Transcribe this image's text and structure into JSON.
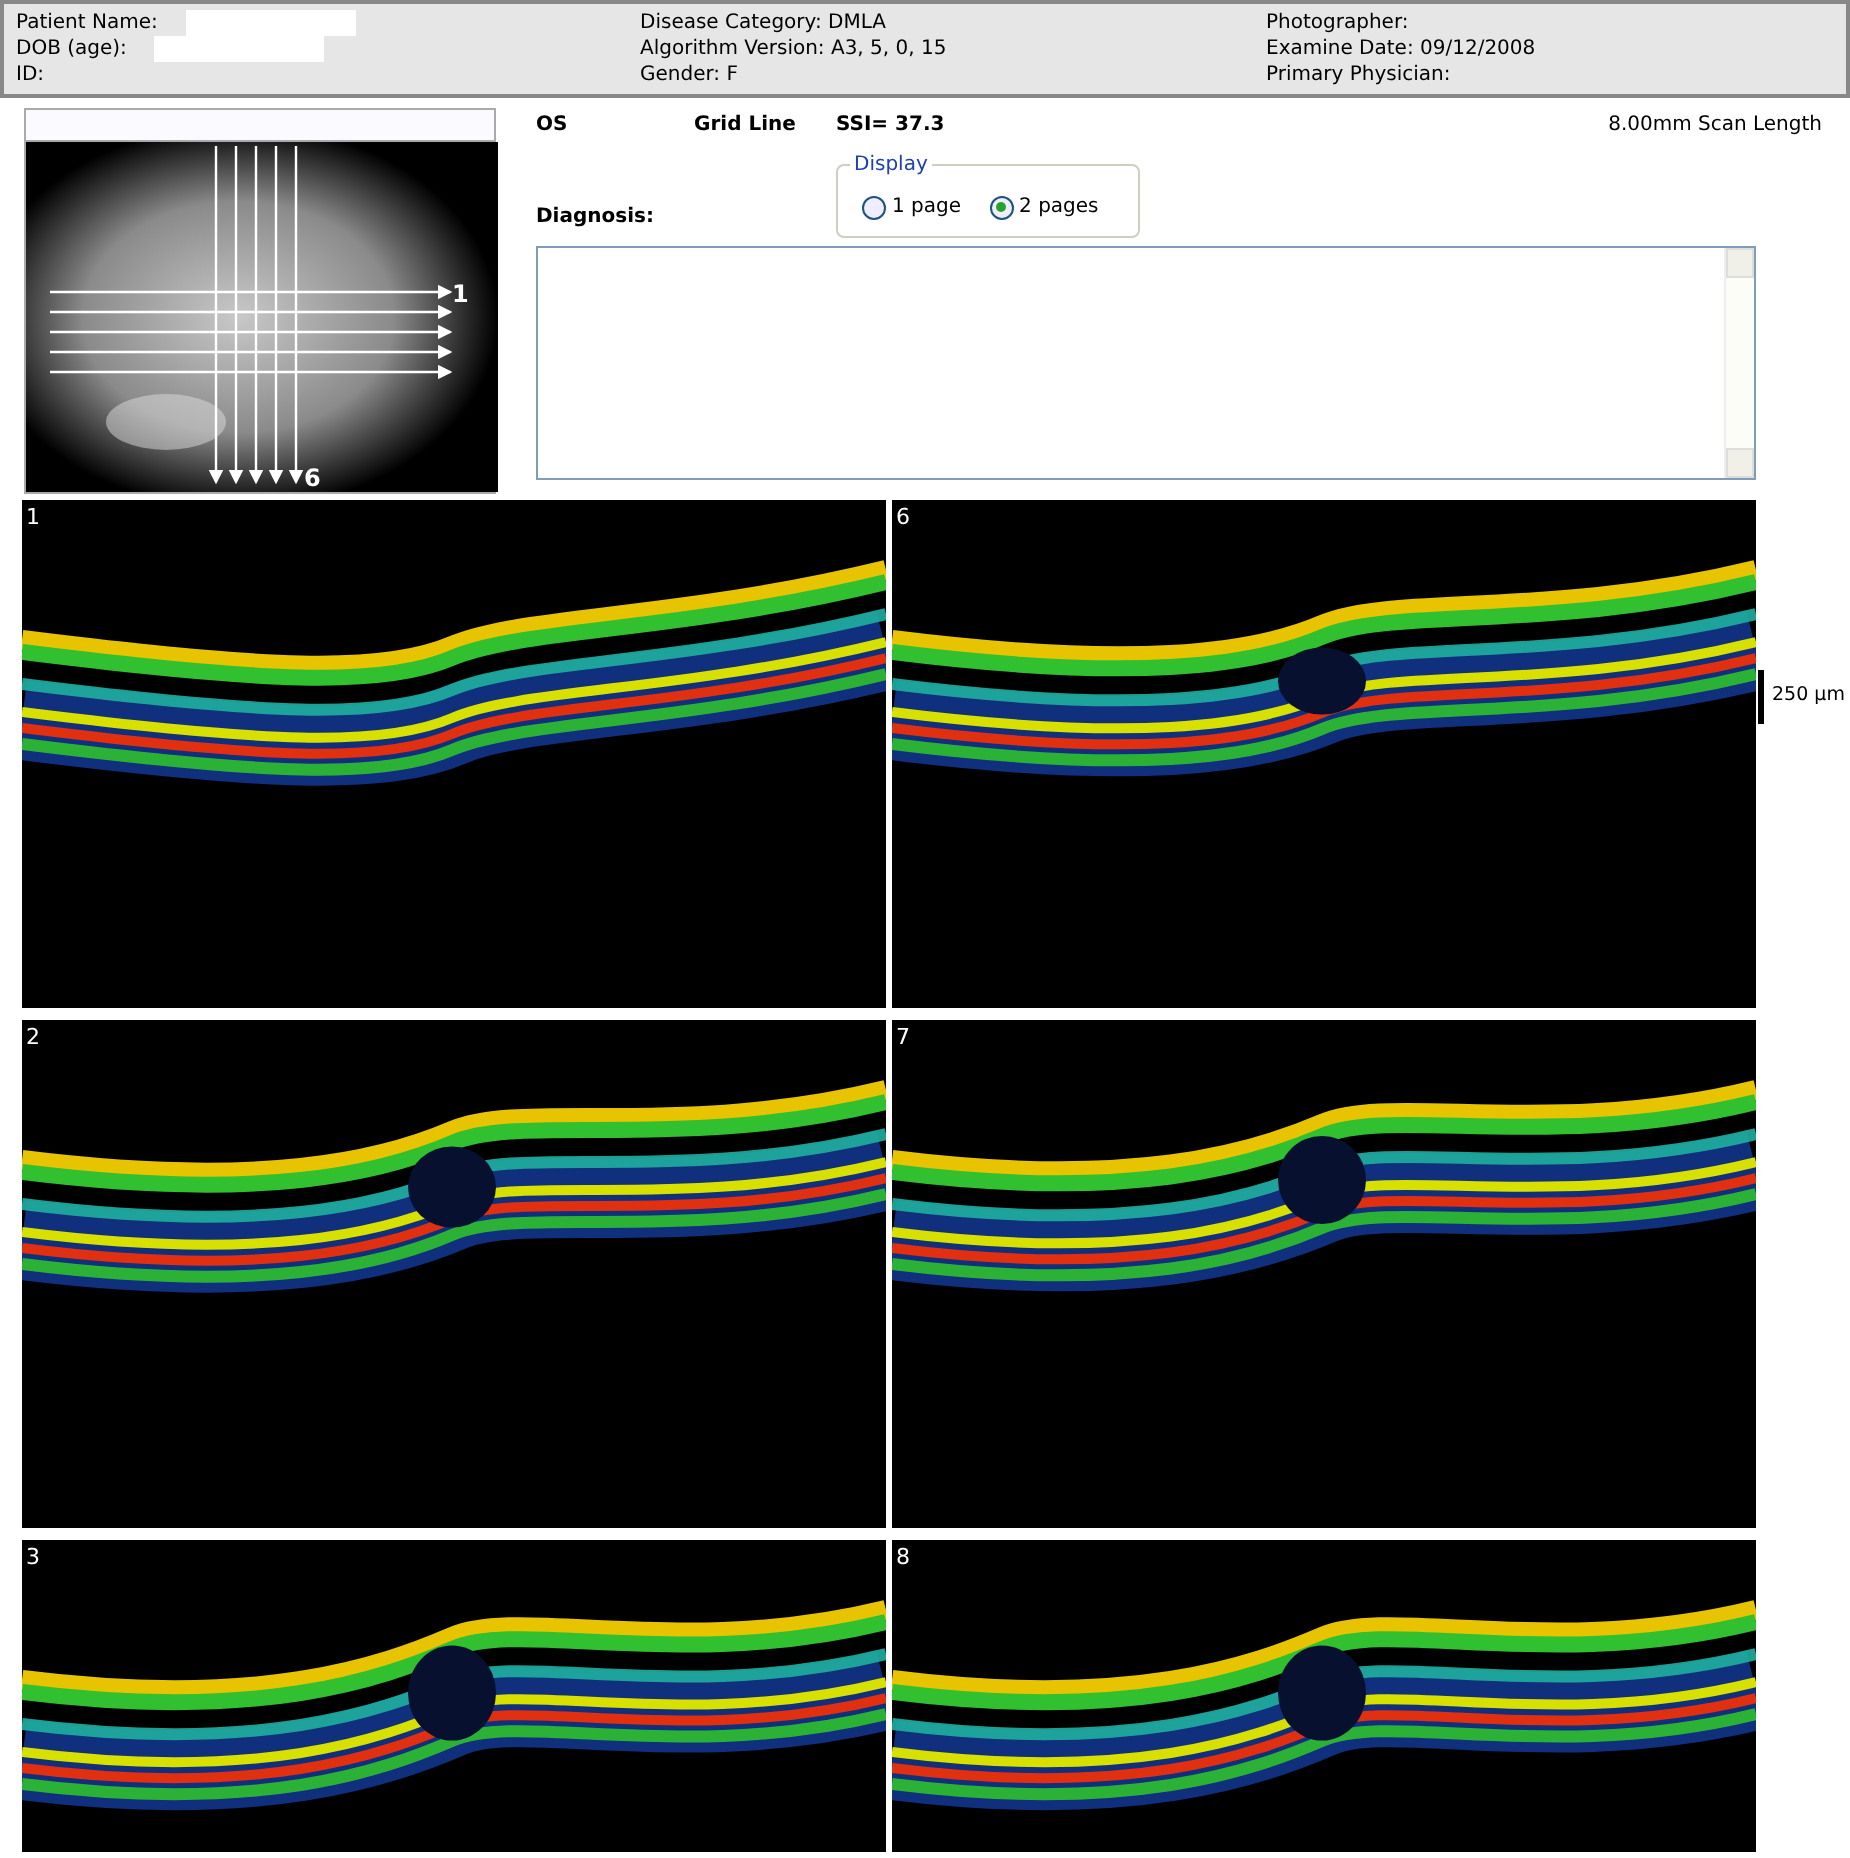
{
  "header": {
    "columns": [
      [
        {
          "text": "Patient Name:",
          "redacted": true
        },
        {
          "text": "DOB (age):",
          "redacted": true
        },
        {
          "text": "ID:",
          "redacted": false
        }
      ],
      [
        {
          "text": "Disease Category: DMLA",
          "redacted": false
        },
        {
          "text": "Algorithm Version: A3, 5, 0, 15",
          "redacted": false
        },
        {
          "text": "Gender: F",
          "redacted": false
        }
      ],
      [
        {
          "text": "Photographer:",
          "redacted": false
        },
        {
          "text": "Examine Date: 09/12/2008",
          "redacted": false
        },
        {
          "text": "Primary Physician:",
          "redacted": false
        }
      ]
    ]
  },
  "fundus": {
    "first_line_label": "1",
    "last_line_label": "6"
  },
  "info": {
    "eye": "OS",
    "pattern": "Grid Line",
    "ssi": "SSI= 37.3",
    "scan_length": "8.00mm Scan Length"
  },
  "display": {
    "legend": "Display",
    "options": [
      {
        "label": "1 page",
        "selected": false
      },
      {
        "label": "2 pages",
        "selected": true
      }
    ]
  },
  "diagnosis": {
    "label": "Diagnosis:"
  },
  "scale_bar": "250 µm",
  "scans": [
    {
      "label": "1"
    },
    {
      "label": "6"
    },
    {
      "label": "2"
    },
    {
      "label": "7"
    },
    {
      "label": "3"
    },
    {
      "label": "8"
    }
  ]
}
